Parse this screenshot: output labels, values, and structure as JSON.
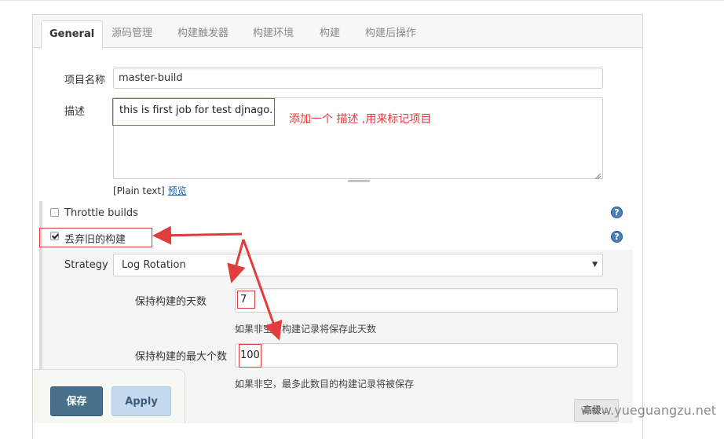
{
  "tabs": [
    {
      "label": "General",
      "active": true
    },
    {
      "label": "源码管理"
    },
    {
      "label": "构建触发器"
    },
    {
      "label": "构建环境"
    },
    {
      "label": "构建"
    },
    {
      "label": "构建后操作"
    }
  ],
  "general": {
    "project_name_label": "项目名称",
    "project_name_value": "master-build",
    "description_label": "描述",
    "description_value": "this is first job for test djnago.",
    "description_annotation": "添加一个 描述 ,用来标记项目",
    "format_text": "[Plain text]",
    "preview_link": "预览",
    "throttle_builds_label": "Throttle builds",
    "throttle_builds_checked": false,
    "discard_old_builds_label": "丢弃旧的构建",
    "discard_old_builds_checked": true,
    "help_glyph": "?"
  },
  "discard": {
    "strategy_label": "Strategy",
    "strategy_value": "Log Rotation",
    "days_label": "保持构建的天数",
    "days_value": "7",
    "days_help": "如果非空，构建记录将保存此天数",
    "max_label": "保持构建的最大个数",
    "max_value": "100",
    "max_help": "如果非空，最多此数目的构建记录将被保存",
    "advanced_label": "高级..."
  },
  "actions": {
    "save_label": "保存",
    "apply_label": "Apply"
  },
  "watermark": "www.yueguangzu.net",
  "colors": {
    "annotation_red": "#e23c3c",
    "save_button": "#49708a",
    "apply_button": "#c5daef",
    "help_icon": "#4e7fb7"
  }
}
